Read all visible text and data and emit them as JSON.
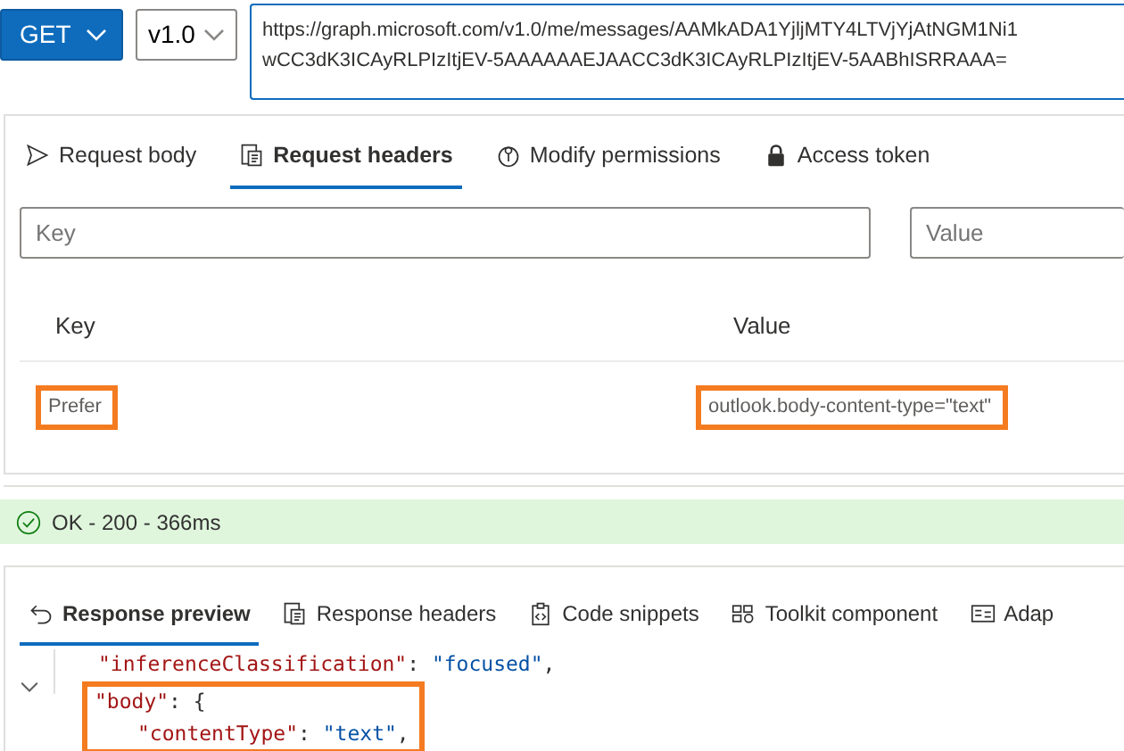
{
  "request": {
    "method": "GET",
    "version": "v1.0",
    "url_lines": [
      "https://graph.microsoft.com/v1.0/me/messages/AAMkADA1YjljMTY4LTVjYjAtNGM1Ni1",
      "wCC3dK3ICAyRLPIzItjEV-5AAAAAAEJAACC3dK3ICAyRLPIzItjEV-5AABhISRRAAA="
    ]
  },
  "request_tabs": [
    {
      "label": "Request body",
      "selected": false
    },
    {
      "label": "Request headers",
      "selected": true
    },
    {
      "label": "Modify permissions",
      "selected": false
    },
    {
      "label": "Access token",
      "selected": false
    }
  ],
  "header_inputs": {
    "key_placeholder": "Key",
    "value_placeholder": "Value"
  },
  "headers_table": {
    "columns": [
      "Key",
      "Value"
    ],
    "rows": [
      {
        "key": "Prefer",
        "value": "outlook.body-content-type=\"text\"",
        "highlighted": true
      }
    ]
  },
  "status": {
    "text": "OK - 200 - 366ms",
    "kind": "success"
  },
  "response_tabs": [
    {
      "label": "Response preview",
      "selected": true
    },
    {
      "label": "Response headers",
      "selected": false
    },
    {
      "label": "Code snippets",
      "selected": false
    },
    {
      "label": "Toolkit component",
      "selected": false
    },
    {
      "label": "Adap",
      "selected": false
    }
  ],
  "code": [
    {
      "tokens": [
        {
          "kind": "key",
          "text": "\"inferenceClassification\""
        },
        {
          "kind": "punct",
          "text": ": "
        },
        {
          "kind": "string",
          "text": "\"focused\""
        },
        {
          "kind": "punct",
          "text": ","
        }
      ]
    },
    {
      "tokens": [
        {
          "kind": "key",
          "text": "\"body\""
        },
        {
          "kind": "punct",
          "text": ": {"
        }
      ],
      "foldable": true,
      "highlighted": true,
      "children": [
        {
          "tokens": [
            {
              "kind": "key",
              "text": "\"contentType\""
            },
            {
              "kind": "punct",
              "text": ": "
            },
            {
              "kind": "string",
              "text": "\"text\""
            },
            {
              "kind": "punct",
              "text": ","
            }
          ]
        }
      ]
    }
  ]
}
